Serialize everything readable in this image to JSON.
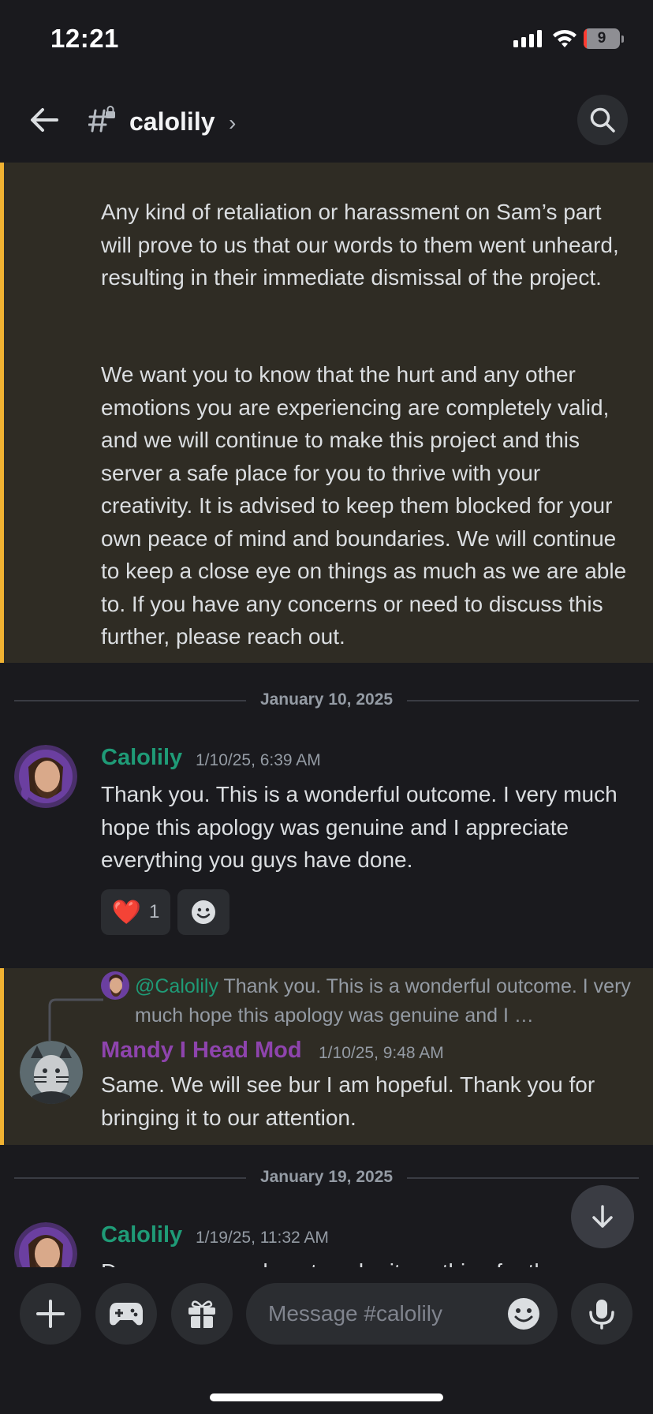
{
  "status_bar": {
    "time": "12:21",
    "battery": "9",
    "battery_level": 0.09
  },
  "header": {
    "channel_name": "calolily",
    "chevron": "›"
  },
  "pinned_message": {
    "paragraph1": "Any kind of retaliation or harassment on Sam’s part will prove to us that our words to them went unheard, resulting in their immediate dismissal of the project.",
    "paragraph2": "We want you to know that the hurt and any other emotions you are experiencing are completely valid, and we will continue to make this project and this server a safe place for you to thrive with your creativity. It is advised to keep them blocked for your own peace of mind and boundaries. We will continue to keep a close eye on things as much as we are able to. If you have any concerns or need to discuss this further, please reach out."
  },
  "dates": {
    "first": "January 10, 2025",
    "second": "January 19, 2025"
  },
  "messages": [
    {
      "author": "Calolily",
      "timestamp": "1/10/25, 6:39 AM",
      "text": "Thank you. This is a wonderful outcome. I very much hope this apology was genuine and I appreciate everything you guys have done.",
      "reaction_emoji": "❤️",
      "reaction_count": "1"
    },
    {
      "reply_mention": "@Calolily",
      "reply_preview": "Thank you. This is a wonderful outcome. I very much hope this apology was genuine and I …",
      "author": "Mandy I Head Mod",
      "timestamp": "1/10/25, 9:48 AM",
      "text": "Same. We will see bur I am hopeful. Thank you for bringing it to our attention."
    },
    {
      "author": "Calolily",
      "timestamp": "1/19/25, 11:32 AM",
      "text": "Do you you need me to submit anything for the"
    }
  ],
  "composer": {
    "placeholder": "Message #calolily"
  },
  "colors": {
    "background": "#1a1a1e",
    "highlight": "#2f2c24",
    "highlight_bar": "#f0b232",
    "calolily_name": "#1f9b77",
    "mandy_name": "#8e44ad"
  },
  "icons": [
    "back-arrow-icon",
    "channel-lock-icon",
    "search-icon",
    "plus-icon",
    "gamepad-icon",
    "gift-icon",
    "emoji-icon",
    "microphone-icon",
    "arrow-down-icon",
    "add-reaction-icon",
    "reply-spine-icon"
  ]
}
